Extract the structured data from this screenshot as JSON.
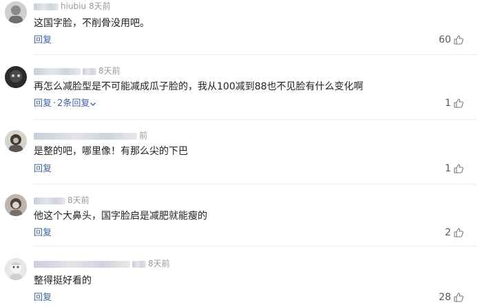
{
  "comments": [
    {
      "username_visible": "hiubiu",
      "time": "8天前",
      "text": "这国字脸，不削骨没用吧。",
      "reply_label": "回复",
      "replies_label": "",
      "likes": "60"
    },
    {
      "username_visible": "",
      "time": "8天前",
      "text": "再怎么减脸型是不可能减成瓜子脸的，我从100减到88也不见脸有什么变化啊",
      "reply_label": "回复",
      "replies_label": "2条回复",
      "likes": "1"
    },
    {
      "username_visible": "",
      "time": "前",
      "text": "是整的吧，哪里像！有那么尖的下巴",
      "reply_label": "回复",
      "replies_label": "",
      "likes": "1"
    },
    {
      "username_visible": "",
      "time": "8天前",
      "text": "他这个大鼻头，国字脸启是减肥就能瘦的",
      "reply_label": "回复",
      "replies_label": "",
      "likes": "2"
    },
    {
      "username_visible": "",
      "time": "8天前",
      "text": "整得挺好看的",
      "reply_label": "回复",
      "replies_label": "",
      "likes": "28"
    }
  ],
  "colors": {
    "link": "#406599",
    "meta": "#9a9a9a",
    "divider": "#ececec"
  },
  "icons": {
    "like": "thumbs-up-icon",
    "expand": "chevron-down-icon"
  }
}
